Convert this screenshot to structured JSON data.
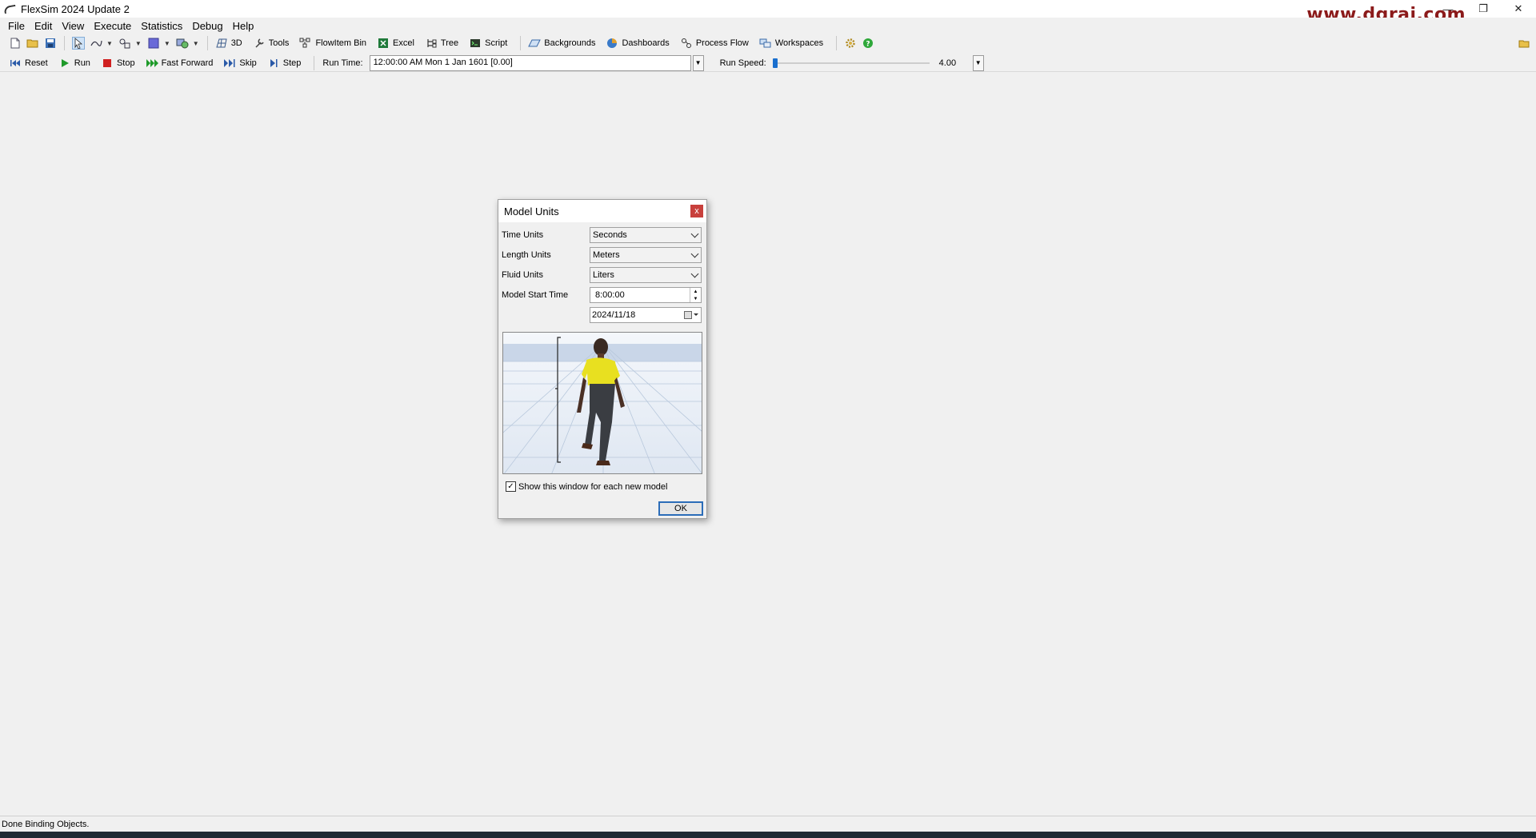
{
  "window": {
    "title": "FlexSim 2024 Update 2",
    "watermark": "www.dgrai.com",
    "controls": {
      "minimize": "—",
      "restore": "❐",
      "close": "✕"
    }
  },
  "menu": [
    "File",
    "Edit",
    "View",
    "Execute",
    "Statistics",
    "Debug",
    "Help"
  ],
  "toolbar": {
    "view3d": "3D",
    "tools": "Tools",
    "flowitem_bin": "FlowItem Bin",
    "excel": "Excel",
    "tree": "Tree",
    "script": "Script",
    "backgrounds": "Backgrounds",
    "dashboards": "Dashboards",
    "process_flow": "Process Flow",
    "workspaces": "Workspaces"
  },
  "run_controls": {
    "reset": "Reset",
    "run": "Run",
    "stop": "Stop",
    "fast_forward": "Fast Forward",
    "skip": "Skip",
    "step": "Step",
    "run_time_label": "Run Time:",
    "run_time_value": "12:00:00 AM  Mon 1 Jan 1601  [0.00]",
    "run_speed_label": "Run Speed:",
    "run_speed_value": "4.00",
    "run_speed_fraction": 0.0
  },
  "status": {
    "text": "Done Binding Objects."
  },
  "dialog": {
    "title": "Model Units",
    "close": "x",
    "time_units_label": "Time Units",
    "time_units_value": "Seconds",
    "length_units_label": "Length Units",
    "length_units_value": "Meters",
    "fluid_units_label": "Fluid Units",
    "fluid_units_value": "Liters",
    "start_time_label": "Model Start Time",
    "start_time_value": "8:00:00",
    "start_date_value": "2024/11/18",
    "show_window_label": "Show this window for each new model",
    "show_window_checked": true,
    "ok": "OK"
  },
  "colors": {
    "accent": "#1a6fce",
    "close_button": "#c8403c",
    "watermark": "#8b1a1a",
    "shirt": "#e8e020"
  }
}
